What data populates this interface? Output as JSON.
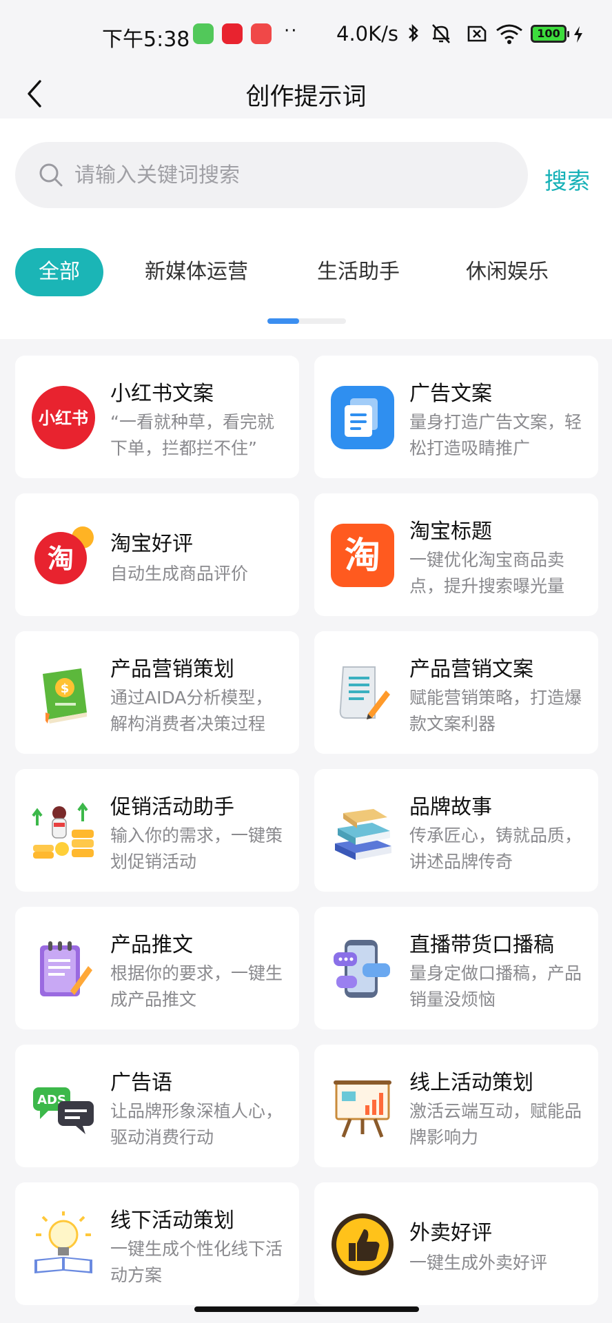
{
  "status_bar": {
    "time": "下午5:38",
    "dots": "··",
    "network_speed": "4.0K/s",
    "battery_level": "100"
  },
  "nav": {
    "title": "创作提示词"
  },
  "search": {
    "placeholder": "请输入关键词搜索",
    "button_label": "搜索"
  },
  "tabs": [
    {
      "label": "全部",
      "active": true
    },
    {
      "label": "新媒体运营"
    },
    {
      "label": "生活助手"
    },
    {
      "label": "休闲娱乐"
    }
  ],
  "cards": [
    {
      "title": "小红书文案",
      "desc": "“一看就种草，看完就下单，拦都拦不住”",
      "icon": "xiaohongshu-icon",
      "icon_text": "小红书"
    },
    {
      "title": "广告文案",
      "desc": "量身打造广告文案，轻松打造吸睛推广",
      "icon": "document-copy-icon"
    },
    {
      "title": "淘宝好评",
      "desc": "自动生成商品评价",
      "icon": "taobao-review-icon",
      "icon_text": "淘"
    },
    {
      "title": "淘宝标题",
      "desc": "一键优化淘宝商品卖点，提升搜索曝光量",
      "icon": "taobao-icon",
      "icon_text": "淘"
    },
    {
      "title": "产品营销策划",
      "desc": "通过AIDA分析模型，解构消费者决策过程",
      "icon": "green-book-icon"
    },
    {
      "title": "产品营销文案",
      "desc": "赋能营销策略，打造爆款文案利器",
      "icon": "paper-pen-icon"
    },
    {
      "title": "促销活动助手",
      "desc": "输入你的需求，一键策划促销活动",
      "icon": "promotion-coins-icon"
    },
    {
      "title": "品牌故事",
      "desc": "传承匠心，铸就品质，讲述品牌传奇",
      "icon": "book-stack-icon"
    },
    {
      "title": "产品推文",
      "desc": "根据你的要求，一键生成产品推文",
      "icon": "notepad-icon"
    },
    {
      "title": "直播带货口播稿",
      "desc": "量身定做口播稿，产品销量没烦恼",
      "icon": "phone-chat-icon"
    },
    {
      "title": "广告语",
      "desc": "让品牌形象深植人心，驱动消费行动",
      "icon": "ads-bubble-icon",
      "icon_text": "ADS"
    },
    {
      "title": "线上活动策划",
      "desc": "激活云端互动，赋能品牌影响力",
      "icon": "easel-chart-icon"
    },
    {
      "title": "线下活动策划",
      "desc": "一键生成个性化线下活动方案",
      "icon": "lightbulb-book-icon"
    },
    {
      "title": "外卖好评",
      "desc": "一键生成外卖好评",
      "icon": "thumbs-up-badge-icon"
    }
  ],
  "colors": {
    "accent": "#1bb5b6",
    "search_link": "#16b1b7",
    "indicator": "#3b8ef0",
    "xiaohongshu_red": "#e8232f",
    "taobao_orange": "#ff5a1f"
  }
}
